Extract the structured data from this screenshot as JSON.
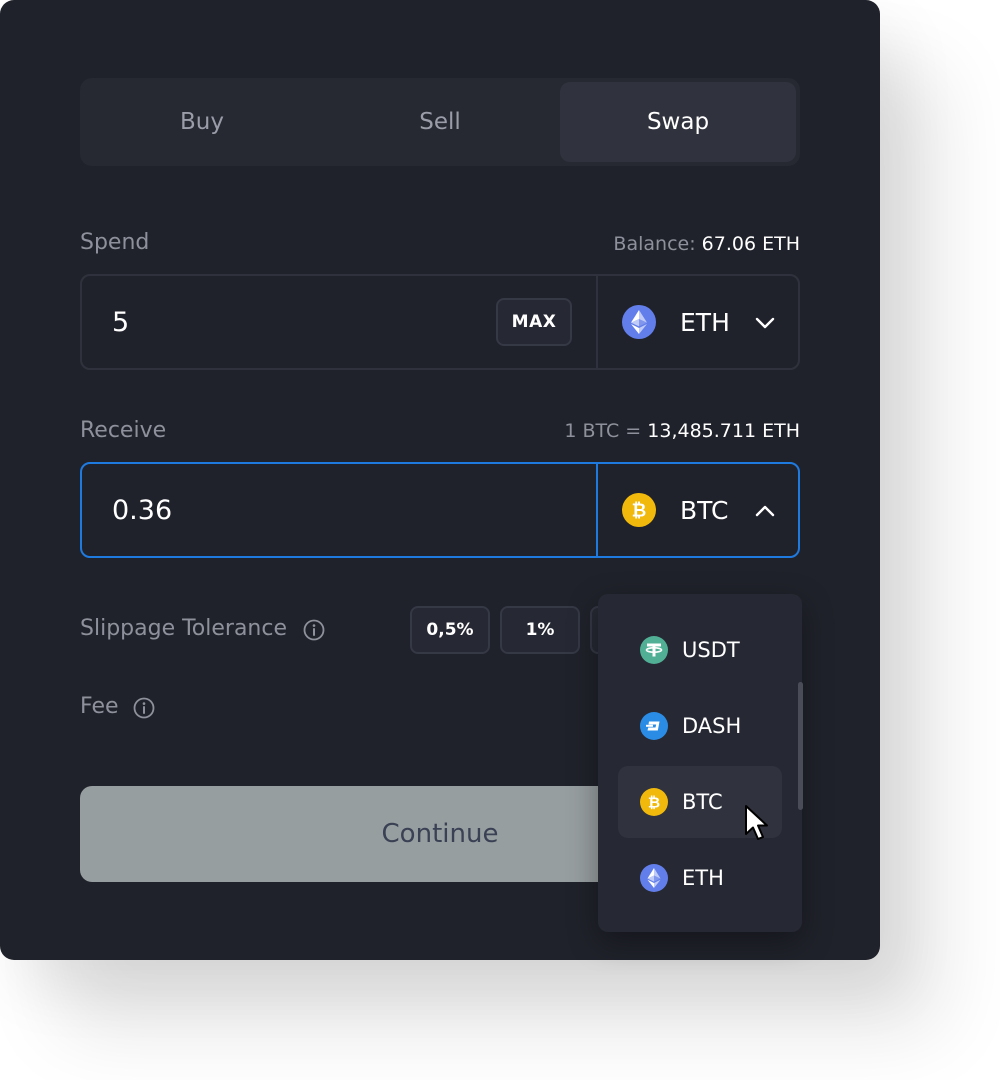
{
  "tabs": [
    {
      "label": "Buy",
      "active": false
    },
    {
      "label": "Sell",
      "active": false
    },
    {
      "label": "Swap",
      "active": true
    }
  ],
  "spend": {
    "label": "Spend",
    "balance_label": "Balance:",
    "balance_value": "67.06 ETH",
    "amount": "5",
    "max_label": "MAX",
    "coin": "ETH",
    "coin_icon": "ethereum-icon",
    "dropdown_state": "collapsed"
  },
  "receive": {
    "label": "Receive",
    "rate_label": "1 BTC =",
    "rate_value": "13,485.711 ETH",
    "amount": "0.36",
    "coin": "BTC",
    "coin_icon": "bitcoin-icon",
    "dropdown_state": "expanded",
    "focused": true
  },
  "slippage": {
    "label": "Slippage Tolerance",
    "options": [
      "0,5%",
      "1%"
    ]
  },
  "fee": {
    "label": "Fee"
  },
  "continue_label": "Continue",
  "coin_dropdown": {
    "items": [
      {
        "symbol": "USDT",
        "icon": "tether-icon",
        "color": "#50af95"
      },
      {
        "symbol": "DASH",
        "icon": "dash-icon",
        "color": "#008de4"
      },
      {
        "symbol": "BTC",
        "icon": "bitcoin-icon",
        "color": "#f0b90b",
        "hovered": true
      },
      {
        "symbol": "ETH",
        "icon": "ethereum-icon",
        "color": "#627eea"
      }
    ]
  },
  "colors": {
    "background": "#20222b",
    "accent_focus": "#1f7ae0",
    "continue_disabled": "#979ea0"
  }
}
